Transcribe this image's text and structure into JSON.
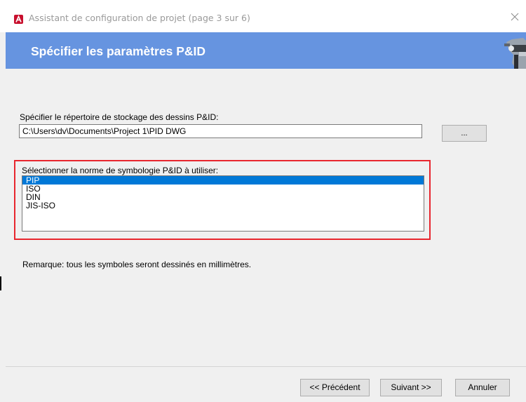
{
  "window": {
    "title": "Assistant de configuration de projet (page 3 sur 6)",
    "app_icon": "autocad-plant-icon",
    "close_icon": "close-icon"
  },
  "header": {
    "title": "Spécifier les paramètres P&ID",
    "graphic": "pipe-graphic"
  },
  "storage": {
    "label": "Spécifier le répertoire de stockage des dessins P&ID:",
    "path_value": "C:\\Users\\dv\\Documents\\Project 1\\PID DWG",
    "browse_label": "..."
  },
  "symbology": {
    "label": "Sélectionner la norme de symbologie P&ID à utiliser:",
    "options": [
      "PIP",
      "ISO",
      "DIN",
      "JIS-ISO"
    ],
    "selected": "PIP"
  },
  "note": "Remarque: tous les symboles seront dessinés en millimètres.",
  "footer": {
    "previous_label": "<< Précédent",
    "next_label": "Suivant >>",
    "cancel_label": "Annuler"
  },
  "colors": {
    "header_band": "#6694e0",
    "selection": "#0078d7",
    "highlight_border": "#e8262e",
    "app_icon": "#c8102e"
  }
}
